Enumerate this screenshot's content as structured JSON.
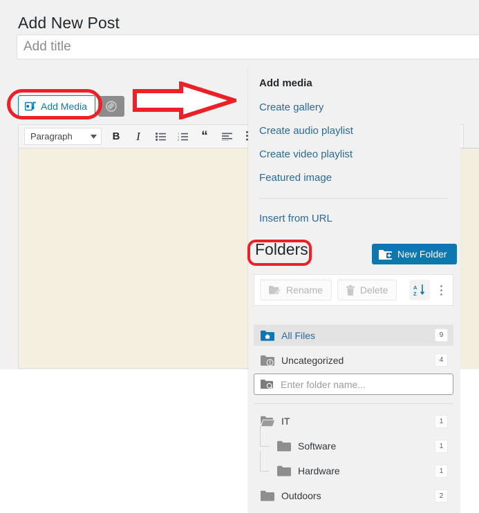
{
  "page": {
    "title": "Add New Post"
  },
  "title_field": {
    "placeholder": "Add title",
    "value": ""
  },
  "media_buttons": {
    "add_media_label": "Add Media",
    "add_media_icon": "media-camera-music-icon",
    "second_button_icon": "paperclip-attachment-icon"
  },
  "editor_toolbar": {
    "format_select_value": "Paragraph",
    "buttons": [
      {
        "label": "B",
        "name": "bold-button"
      },
      {
        "label": "I",
        "name": "italic-button"
      },
      {
        "label": "",
        "name": "bulleted-list-button"
      },
      {
        "label": "",
        "name": "numbered-list-button"
      },
      {
        "label": "“",
        "name": "blockquote-button"
      },
      {
        "label": "",
        "name": "align-left-button"
      },
      {
        "label": "",
        "name": "toolbar-toggle-button"
      }
    ]
  },
  "media_panel": {
    "heading": "Add media",
    "links": [
      {
        "label": "Create gallery",
        "name": "create-gallery-link"
      },
      {
        "label": "Create audio playlist",
        "name": "create-audio-playlist-link"
      },
      {
        "label": "Create video playlist",
        "name": "create-video-playlist-link"
      },
      {
        "label": "Featured image",
        "name": "featured-image-link"
      },
      {
        "label": "Insert from URL",
        "name": "insert-from-url-link"
      }
    ]
  },
  "folders": {
    "title": "Folders",
    "new_folder_label": "New Folder",
    "toolbar": {
      "rename_label": "Rename",
      "delete_label": "Delete",
      "sort_icon": "sort-az-descending-icon",
      "more_icon": "vertical-dots-more-icon"
    },
    "search": {
      "placeholder": "Enter folder name...",
      "value": "",
      "icon": "folder-search-icon"
    },
    "special_items": [
      {
        "label": "All Files",
        "count": "9",
        "icon": "folder-home-icon",
        "selected": true
      },
      {
        "label": "Uncategorized",
        "count": "4",
        "icon": "folder-uncategorized-icon",
        "selected": false
      }
    ],
    "tree": [
      {
        "label": "IT",
        "count": "1",
        "depth": 0,
        "icon": "folder-open-icon"
      },
      {
        "label": "Software",
        "count": "1",
        "depth": 1,
        "icon": "folder-icon"
      },
      {
        "label": "Hardware",
        "count": "1",
        "depth": 1,
        "icon": "folder-icon"
      },
      {
        "label": "Outdoors",
        "count": "2",
        "depth": 0,
        "icon": "folder-icon"
      }
    ]
  },
  "annotations": {
    "arrow": "red-arrow-pointing-right",
    "highlight_add_media": "red-ellipse-around-add-media",
    "highlight_folders": "red-rectangle-around-folders-title"
  },
  "colors": {
    "link_blue": "#2a6a99",
    "accent_blue": "#0f77b0",
    "annotation_red": "#ec2027",
    "editor_bg": "#f5efe0"
  }
}
